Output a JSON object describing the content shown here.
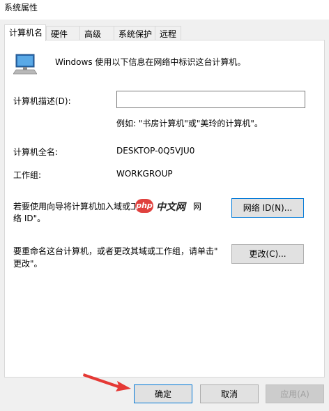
{
  "window": {
    "title": "系统属性"
  },
  "tabs": [
    {
      "label": "计算机名",
      "active": true
    },
    {
      "label": "硬件",
      "active": false
    },
    {
      "label": "高级",
      "active": false
    },
    {
      "label": "系统保护",
      "active": false
    },
    {
      "label": "远程",
      "active": false
    }
  ],
  "computer_name": {
    "intro": "Windows 使用以下信息在网络中标识这台计算机。",
    "description_label": "计算机描述(D):",
    "description_value": "",
    "example": "例如: \"书房计算机\"或\"美玲的计算机\"。",
    "full_name_label": "计算机全名:",
    "full_name_value": "DESKTOP-0Q5VJU0",
    "workgroup_label": "工作组:",
    "workgroup_value": "WORKGROUP",
    "join_text_line1": "若要使用向导将计算机加入域或工",
    "join_text_line1_tail": "网",
    "join_text_line2": "络 ID\"。",
    "network_id_button": "网络 ID(N)...",
    "rename_text_line1": "要重命名这台计算机，或者更改其域或工作组，请单击\"",
    "rename_text_line2": "更改\"。",
    "change_button": "更改(C)..."
  },
  "watermark": {
    "logo": "php",
    "text": "中文网"
  },
  "footer": {
    "ok_button": "确定",
    "cancel_button": "取消",
    "apply_button": "应用(A)"
  },
  "colors": {
    "arrow": "#e53935",
    "focus_border": "#0078d7"
  },
  "icons": {
    "computer": "computer-icon",
    "arrow": "red-arrow-annotation"
  }
}
